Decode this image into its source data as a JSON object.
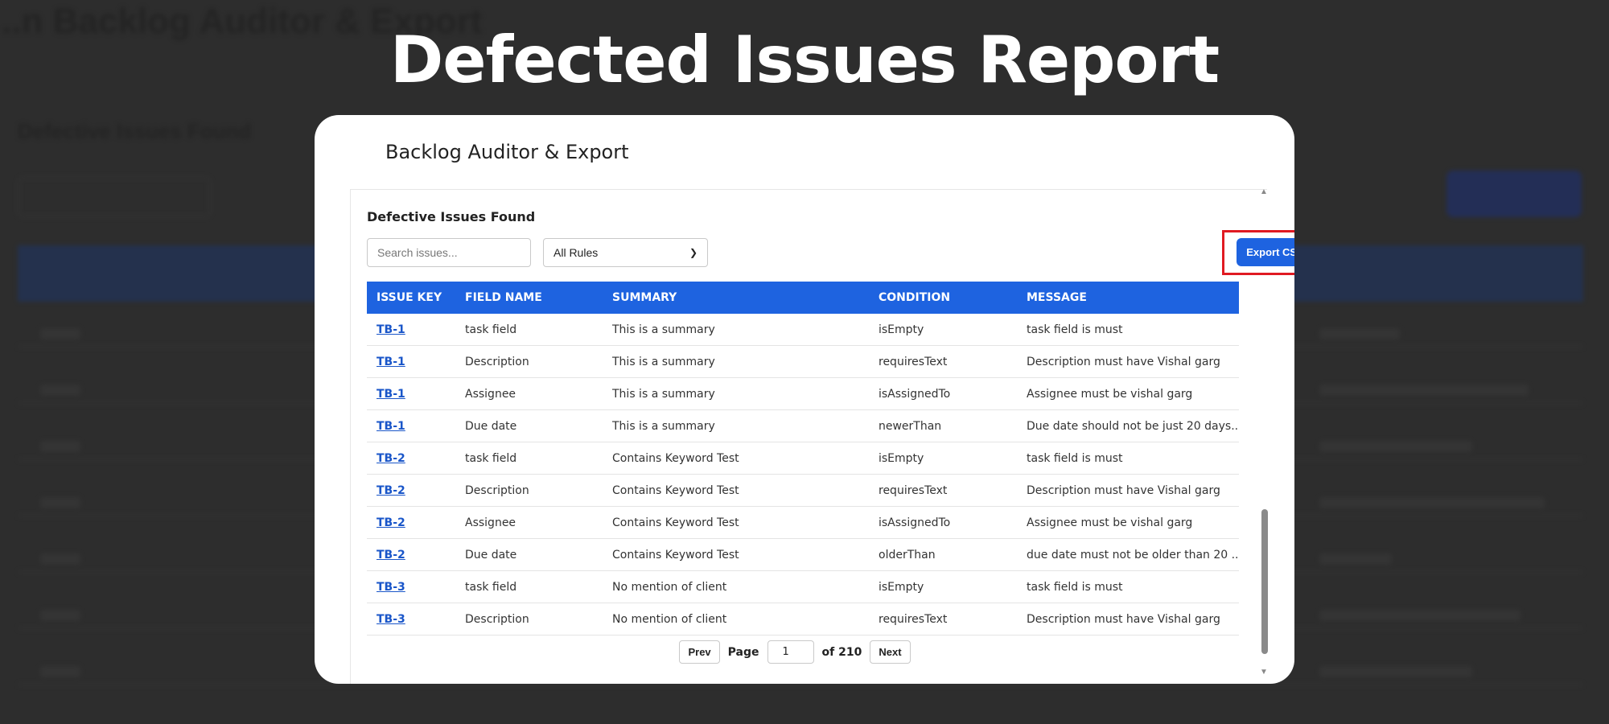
{
  "headline": "Defected Issues Report",
  "background": {
    "title": "...n Backlog Auditor & Export",
    "subtitle": "Defective Issues Found"
  },
  "app": {
    "title": "Backlog Auditor & Export"
  },
  "panel": {
    "title": "Defective Issues Found",
    "search_placeholder": "Search issues...",
    "rule_filter": "All Rules",
    "export_label": "Export CSV"
  },
  "table": {
    "headers": [
      "ISSUE KEY",
      "FIELD NAME",
      "SUMMARY",
      "CONDITION",
      "MESSAGE"
    ],
    "rows": [
      {
        "key": "TB-1",
        "field": "task field",
        "summary": "This is a summary",
        "condition": "isEmpty",
        "message": "task field is must"
      },
      {
        "key": "TB-1",
        "field": "Description",
        "summary": "This is a summary",
        "condition": "requiresText",
        "message": "Description must have Vishal garg"
      },
      {
        "key": "TB-1",
        "field": "Assignee",
        "summary": "This is a summary",
        "condition": "isAssignedTo",
        "message": "Assignee must be vishal garg"
      },
      {
        "key": "TB-1",
        "field": "Due date",
        "summary": "This is a summary",
        "condition": "newerThan",
        "message": "Due date should not be just 20 days..."
      },
      {
        "key": "TB-2",
        "field": "task field",
        "summary": "Contains Keyword Test",
        "condition": "isEmpty",
        "message": "task field is must"
      },
      {
        "key": "TB-2",
        "field": "Description",
        "summary": "Contains Keyword Test",
        "condition": "requiresText",
        "message": "Description must have Vishal garg"
      },
      {
        "key": "TB-2",
        "field": "Assignee",
        "summary": "Contains Keyword Test",
        "condition": "isAssignedTo",
        "message": "Assignee must be vishal garg"
      },
      {
        "key": "TB-2",
        "field": "Due date",
        "summary": "Contains Keyword Test",
        "condition": "olderThan",
        "message": "due date must not be older than 20 ..."
      },
      {
        "key": "TB-3",
        "field": "task field",
        "summary": "No mention of client",
        "condition": "isEmpty",
        "message": "task field is must"
      },
      {
        "key": "TB-3",
        "field": "Description",
        "summary": "No mention of client",
        "condition": "requiresText",
        "message": "Description must have Vishal garg"
      }
    ]
  },
  "pagination": {
    "prev_label": "Prev",
    "page_label": "Page",
    "current_page": "1",
    "total_label": "of 210",
    "next_label": "Next"
  },
  "icons": {
    "chevron": "chevron-down-icon",
    "scroll_up": "triangle-up-icon",
    "scroll_down": "triangle-down-icon"
  },
  "colors": {
    "accent": "#1e63e0",
    "highlight": "#e01a22",
    "backdrop": "#2d2d2d"
  }
}
